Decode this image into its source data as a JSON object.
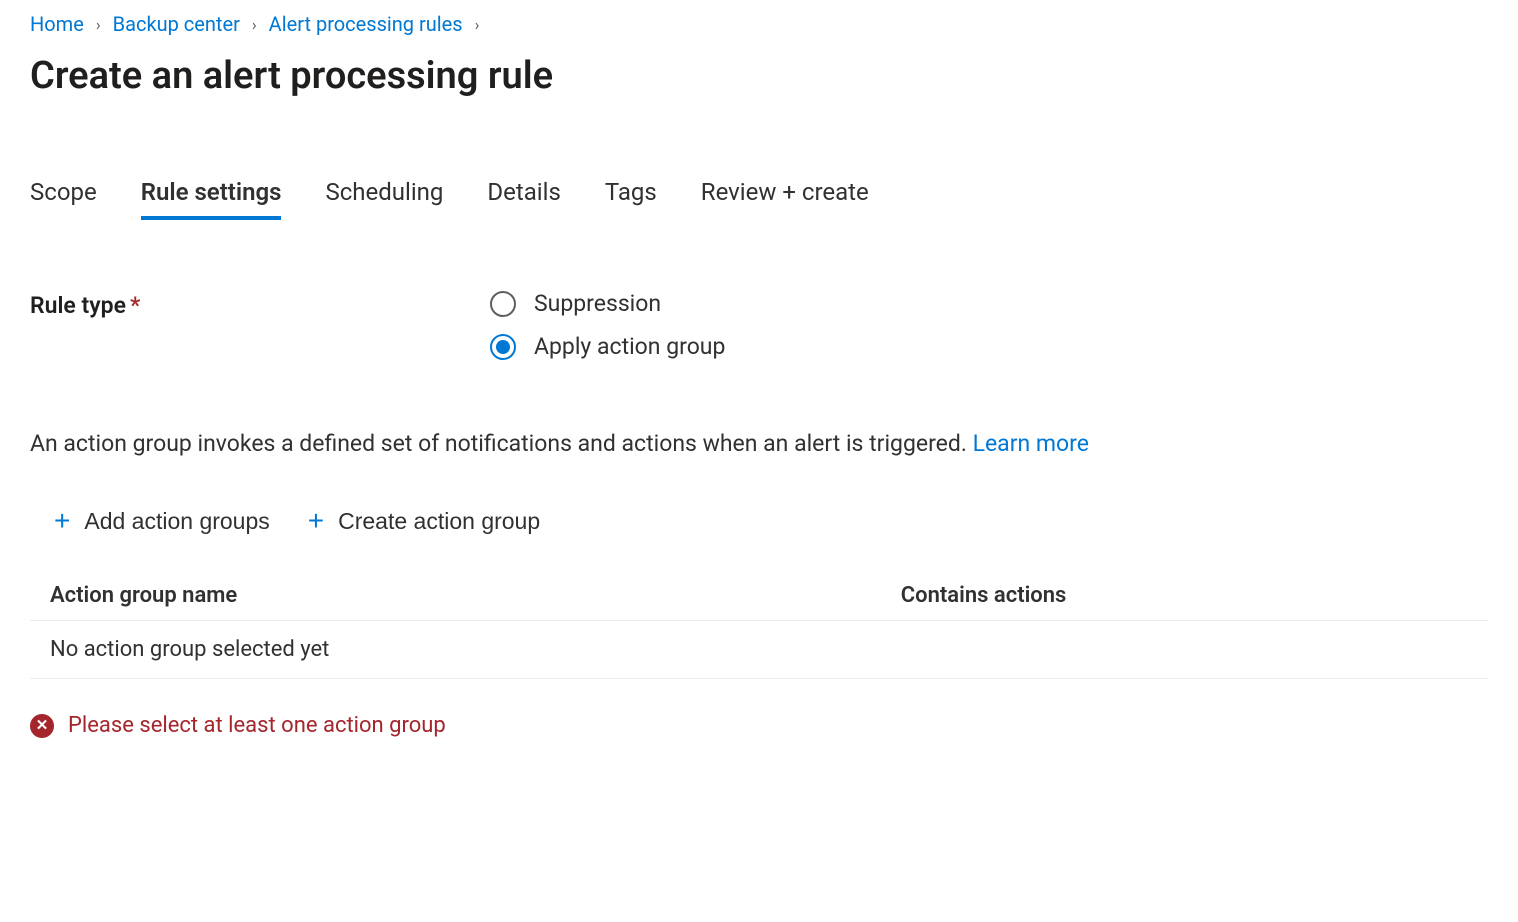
{
  "breadcrumb": {
    "items": [
      {
        "label": "Home"
      },
      {
        "label": "Backup center"
      },
      {
        "label": "Alert processing rules"
      }
    ]
  },
  "page": {
    "title": "Create an alert processing rule"
  },
  "tabs": [
    {
      "label": "Scope",
      "active": false
    },
    {
      "label": "Rule settings",
      "active": true
    },
    {
      "label": "Scheduling",
      "active": false
    },
    {
      "label": "Details",
      "active": false
    },
    {
      "label": "Tags",
      "active": false
    },
    {
      "label": "Review + create",
      "active": false
    }
  ],
  "ruleType": {
    "label": "Rule type",
    "options": [
      {
        "label": "Suppression",
        "selected": false
      },
      {
        "label": "Apply action group",
        "selected": true
      }
    ]
  },
  "description": {
    "text": "An action group invokes a defined set of notifications and actions when an alert is triggered. ",
    "linkText": "Learn more"
  },
  "actionButtons": {
    "add": "Add action groups",
    "create": "Create action group"
  },
  "table": {
    "headers": {
      "name": "Action group name",
      "contains": "Contains actions"
    },
    "emptyRow": "No action group selected yet"
  },
  "error": {
    "text": "Please select at least one action group"
  }
}
